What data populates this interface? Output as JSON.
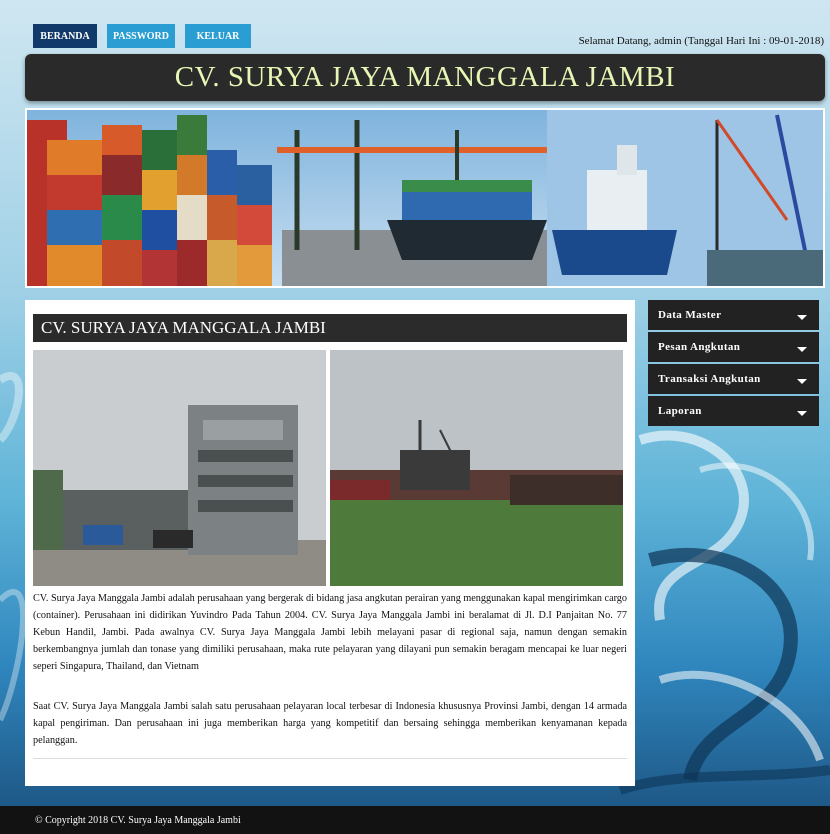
{
  "nav": {
    "beranda": "BERANDA",
    "password": "PASSWORD",
    "keluar": "KELUAR"
  },
  "welcome": "Selamat Datang, admin (Tanggal Hari Ini : 09-01-2018)",
  "header": {
    "title": "CV. SURYA JAYA MANGGALA JAMBI"
  },
  "content": {
    "title": "CV. SURYA JAYA MANGGALA JAMBI",
    "paragraph1": "CV. Surya Jaya Manggala Jambi adalah perusahaan yang bergerak di bidang jasa angkutan perairan yang menggunakan kapal mengirimkan cargo (container). Perusahaan ini didirikan Yuvindro Pada Tahun 2004. CV. Surya Jaya Manggala Jambi ini beralamat di Jl. D.I Panjaitan No. 77 Kebun Handil, Jambi. Pada awalnya CV. Surya Jaya Manggala Jambi lebih melayani pasar di regional saja, namun dengan semakin berkembangnya jumlah dan tonase yang dimiliki perusahaan, maka rute pelayaran yang dilayani pun semakin beragam mencapai ke luar negeri seperi Singapura, Thailand, dan Vietnam",
    "paragraph2": "Saat CV. Surya Jaya Manggala Jambi salah satu perusahaan pelayaran local terbesar di Indonesia khususnya Provinsi Jambi, dengan 14 armada kapal pengiriman. Dan perusahaan ini juga memberikan harga yang kompetitif dan bersaing sehingga memberikan kenyamanan kepada pelanggan."
  },
  "menu": [
    {
      "label": "Data Master"
    },
    {
      "label": "Pesan Angkutan"
    },
    {
      "label": "Transaksi Angkutan"
    },
    {
      "label": "Laporan"
    }
  ],
  "footer": "© Copyright 2018 CV. Surya Jaya Manggala Jambi"
}
